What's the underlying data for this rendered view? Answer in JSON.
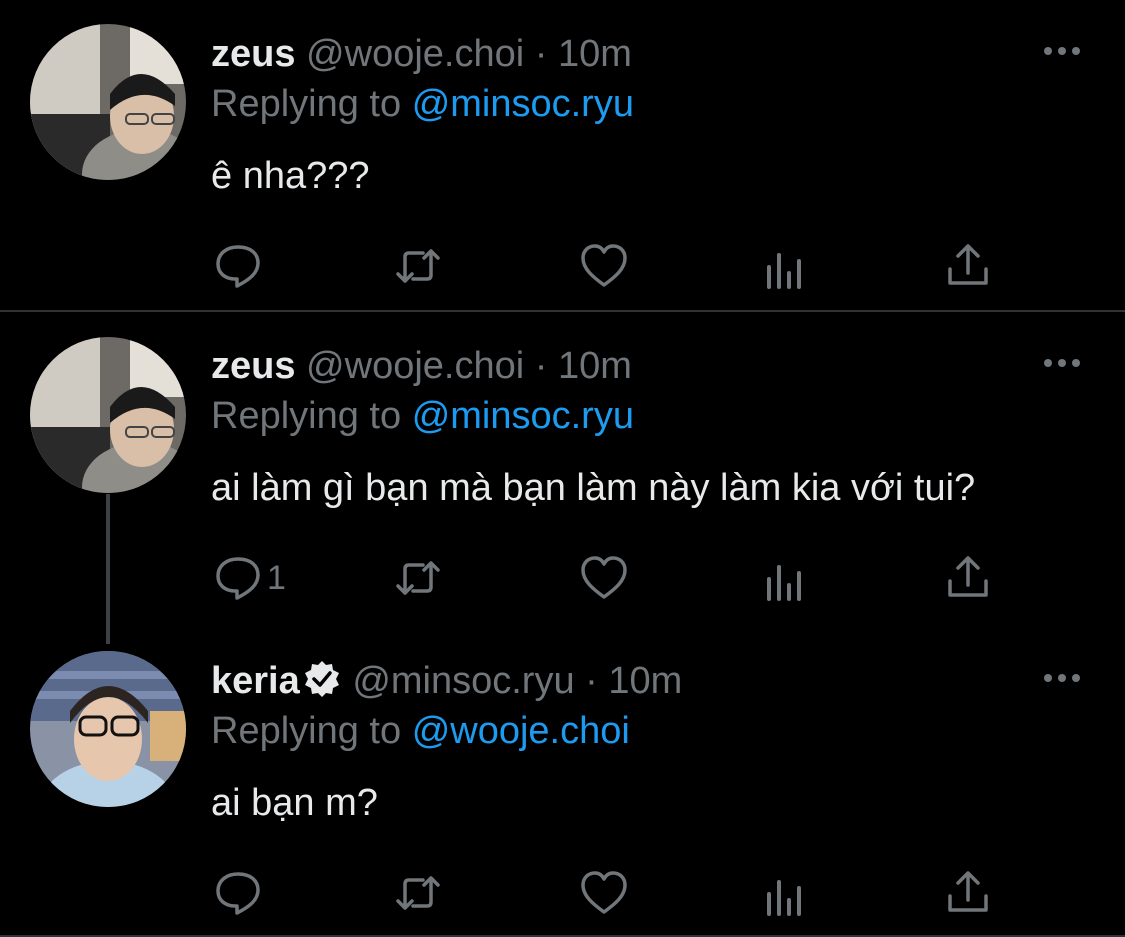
{
  "tweets": [
    {
      "name": "zeus",
      "handle": "@wooje.choi",
      "separator": "·",
      "time": "10m",
      "replying_prefix": "Replying to",
      "replying_to": "@minsoc.ryu",
      "text": "ê nha???",
      "reply_count": "",
      "verified": false,
      "icons": [
        "more-icon",
        "reply-icon",
        "retweet-icon",
        "like-icon",
        "views-icon",
        "share-icon"
      ]
    },
    {
      "name": "zeus",
      "handle": "@wooje.choi",
      "separator": "·",
      "time": "10m",
      "replying_prefix": "Replying to",
      "replying_to": "@minsoc.ryu",
      "text": "ai làm gì bạn mà bạn làm này làm kia với tui?",
      "reply_count": "1",
      "verified": false,
      "icons": [
        "more-icon",
        "reply-icon",
        "retweet-icon",
        "like-icon",
        "views-icon",
        "share-icon"
      ]
    },
    {
      "name": "keria",
      "handle": "@minsoc.ryu",
      "separator": "·",
      "time": "10m",
      "replying_prefix": "Replying to",
      "replying_to": "@wooje.choi",
      "text": "ai bạn m?",
      "reply_count": "",
      "verified": true,
      "icons": [
        "more-icon",
        "verified-badge-icon",
        "reply-icon",
        "retweet-icon",
        "like-icon",
        "views-icon",
        "share-icon"
      ]
    }
  ],
  "colors": {
    "background": "#000000",
    "text": "#e7e9ea",
    "muted": "#71767b",
    "mention": "#1d9bf0",
    "divider": "#2f3336"
  }
}
